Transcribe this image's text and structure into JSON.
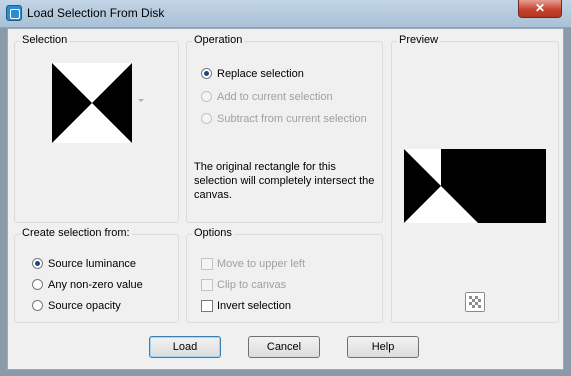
{
  "window": {
    "title": "Load Selection From Disk",
    "close_label": "✕",
    "icon": "app-icon"
  },
  "selection": {
    "label": "Selection",
    "dropdown_icon": "dropdown-arrow-icon"
  },
  "operation": {
    "label": "Operation",
    "options": [
      {
        "label": "Replace selection",
        "selected": true,
        "enabled": true
      },
      {
        "label": "Add to current selection",
        "selected": false,
        "enabled": false
      },
      {
        "label": "Subtract from current selection",
        "selected": false,
        "enabled": false
      }
    ],
    "note": "The original rectangle for this selection will completely intersect the canvas."
  },
  "preview": {
    "label": "Preview",
    "transparency_icon": "checkerboard-icon"
  },
  "create_from": {
    "label": "Create selection from:",
    "options": [
      {
        "label": "Source luminance",
        "selected": true
      },
      {
        "label": "Any non-zero value",
        "selected": false
      },
      {
        "label": "Source opacity",
        "selected": false
      }
    ]
  },
  "options": {
    "label": "Options",
    "items": [
      {
        "label": "Move to upper left",
        "checked": false,
        "enabled": false
      },
      {
        "label": "Clip to canvas",
        "checked": false,
        "enabled": false
      },
      {
        "label": "Invert selection",
        "checked": false,
        "enabled": true
      }
    ]
  },
  "buttons": {
    "load": "Load",
    "cancel": "Cancel",
    "help": "Help"
  }
}
